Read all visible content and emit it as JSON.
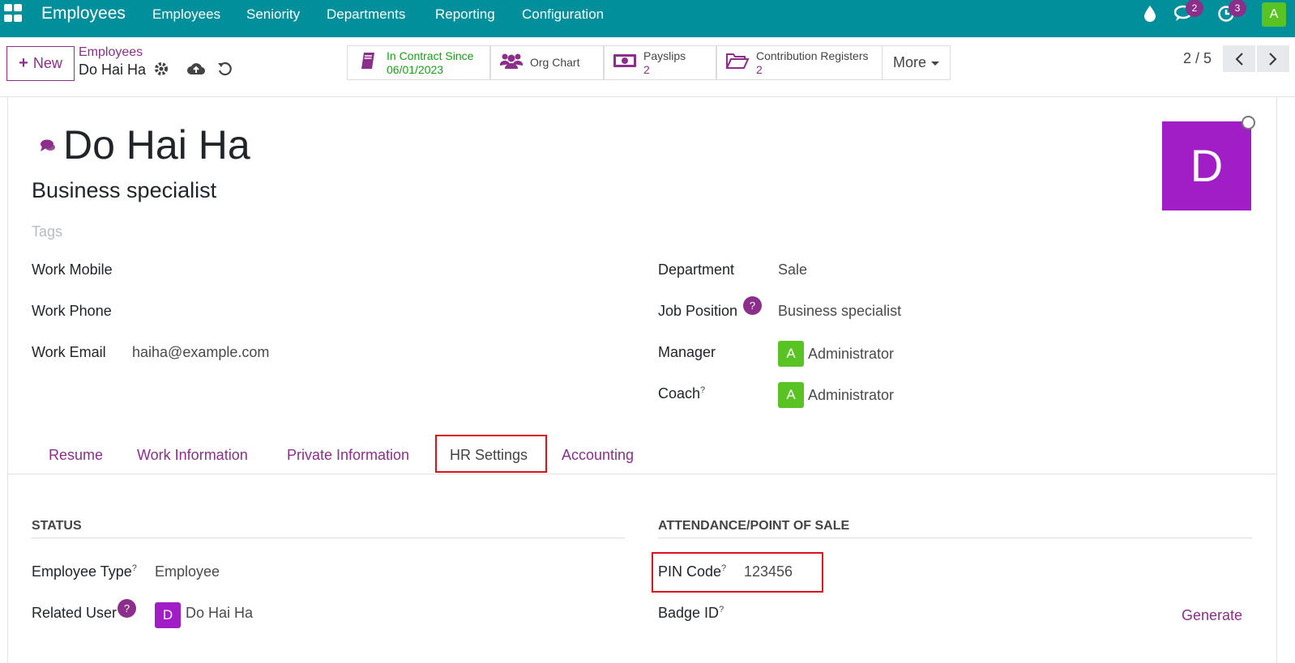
{
  "navbar": {
    "brand": "Employees",
    "menu": [
      "Employees",
      "Seniority",
      "Departments",
      "Reporting",
      "Configuration"
    ],
    "messages_count": "2",
    "activities_count": "3",
    "user_initial": "A"
  },
  "control": {
    "new_label": "New",
    "breadcrumb_parent": "Employees",
    "breadcrumb_current": "Do Hai Ha",
    "smart_buttons": [
      {
        "label": "In Contract Since",
        "value": "06/01/2023"
      },
      {
        "label": "Org Chart",
        "value": ""
      },
      {
        "label": "Payslips",
        "value": "2"
      },
      {
        "label": "Contribution Registers",
        "value": "2"
      }
    ],
    "more_label": "More",
    "pager": "2 / 5"
  },
  "employee": {
    "name": "Do Hai Ha",
    "job_title": "Business specialist",
    "tags_placeholder": "Tags",
    "avatar_initial": "D"
  },
  "fields_left": {
    "work_mobile_label": "Work Mobile",
    "work_phone_label": "Work Phone",
    "work_email_label": "Work Email",
    "work_email_value": "haiha@example.com"
  },
  "fields_right": {
    "department_label": "Department",
    "department_value": "Sale",
    "job_position_label": "Job Position",
    "job_position_value": "Business specialist",
    "manager_label": "Manager",
    "manager_value": "Administrator",
    "coach_label": "Coach",
    "coach_value": "Administrator",
    "avatar_initial": "A"
  },
  "tabs": [
    "Resume",
    "Work Information",
    "Private Information",
    "HR Settings",
    "Accounting"
  ],
  "hr_settings": {
    "status_title": "STATUS",
    "attendance_title": "ATTENDANCE/POINT OF SALE",
    "employee_type_label": "Employee Type",
    "employee_type_value": "Employee",
    "related_user_label": "Related User",
    "related_user_value": "Do Hai Ha",
    "related_user_initial": "D",
    "pin_label": "PIN Code",
    "pin_value": "123456",
    "badge_label": "Badge ID",
    "generate_label": "Generate"
  },
  "help_mark": "?",
  "colors": {
    "navbar": "#018f9c",
    "accent": "#8b2f8a",
    "highlight_box": "#e0101a",
    "avatar_big": "#a11ec7",
    "avatar_admin": "#58c322",
    "contract_green": "#18a018"
  }
}
